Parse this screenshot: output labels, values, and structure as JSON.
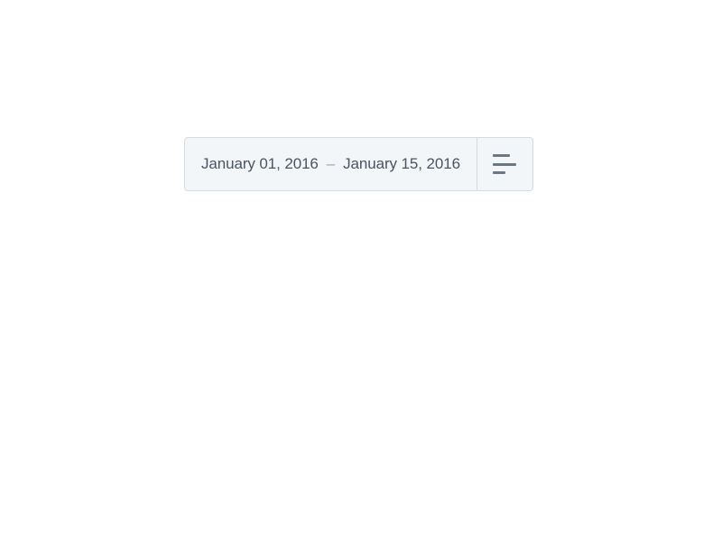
{
  "dateRange": {
    "start": "January 01, 2016",
    "separator": "–",
    "end": "January 15, 2016"
  }
}
